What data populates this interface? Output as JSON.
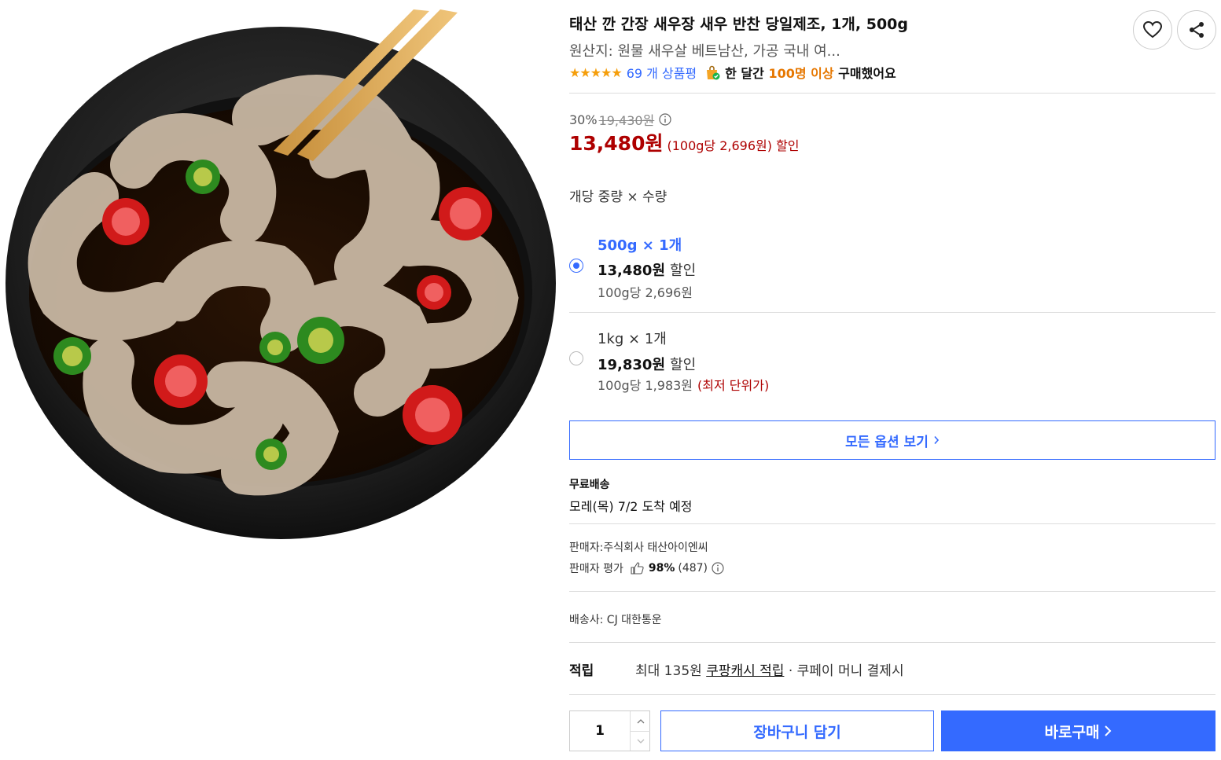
{
  "product": {
    "title": "태산 깐 간장 새우장 새우 반찬 당일제조, 1개, 500g",
    "origin": "원산지: 원물 새우살 베트남산, 가공 국내 여...",
    "stars": "★★★★★",
    "review_count": "69 개 상품평",
    "monthly_prefix": "한 달간",
    "monthly_highlight": "100명 이상",
    "monthly_suffix": "구매했어요"
  },
  "price": {
    "discount_rate": "30%",
    "original_price": "19,430원",
    "sale_price": "13,480원",
    "unit_price": "(100g당 2,696원) 할인"
  },
  "options": {
    "title": "개당 중량 × 수량",
    "items": [
      {
        "name": "500g × 1개",
        "price": "13,480원",
        "tag": "할인",
        "unit": "100g당 2,696원",
        "low_tag": "",
        "selected": true
      },
      {
        "name": "1kg × 1개",
        "price": "19,830원",
        "tag": "할인",
        "unit": "100g당 1,983원",
        "low_tag": "(최저 단위가)",
        "selected": false
      }
    ],
    "view_all": "모든 옵션 보기"
  },
  "shipping": {
    "label": "무료배송",
    "arrival": "모레(목) 7/2 도착 예정"
  },
  "seller": {
    "name": "판매자:주식회사 태산아이엔씨",
    "rating_label": "판매자 평가",
    "rating_pct": "98%",
    "rating_count": "(487)"
  },
  "carrier": "배송사:  CJ 대한통운",
  "reward": {
    "label": "적립",
    "prefix": "최대 135원",
    "link": "쿠팡캐시 적립",
    "suffix": "· 쿠페이 머니 결제시"
  },
  "purchase": {
    "quantity": "1",
    "cart_label": "장바구니 담기",
    "buy_label": "바로구매"
  },
  "colors": {
    "accent": "#346aff",
    "price": "#ae0000",
    "highlight": "#e67700"
  },
  "icons": [
    "heart-icon",
    "share-icon",
    "info-icon",
    "shopping-bag-check-icon",
    "thumbs-up-icon",
    "chevron-right-icon",
    "chevron-up-icon",
    "chevron-down-icon"
  ]
}
